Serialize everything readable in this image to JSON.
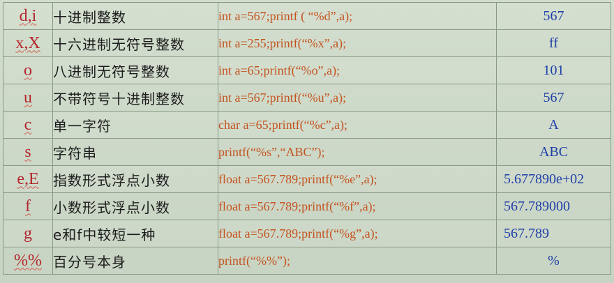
{
  "rows": [
    {
      "spec": "d,i",
      "desc": "十进制整数",
      "code": "int a=567;printf ( “%d”,a);",
      "output": "567"
    },
    {
      "spec": "x,X",
      "desc": "十六进制无符号整数",
      "code": "int a=255;printf(“%x”,a);",
      "output": "ff"
    },
    {
      "spec": "o",
      "desc": "八进制无符号整数",
      "code": "int a=65;printf(“%o”,a);",
      "output": "101"
    },
    {
      "spec": "u",
      "desc": "不带符号十进制整数",
      "code": "int a=567;printf(“%u”,a);",
      "output": "567"
    },
    {
      "spec": "c",
      "desc": "单一字符",
      "code": "char a=65;printf(“%c”,a);",
      "output": "A"
    },
    {
      "spec": "s",
      "desc": "字符串",
      "code": "printf(“%s”,“ABC”);",
      "output": "ABC"
    },
    {
      "spec": "e,E",
      "desc": "指数形式浮点小数",
      "code": "float a=567.789;printf(“%e”,a);",
      "output": "5.677890e+02"
    },
    {
      "spec": "f",
      "desc": "小数形式浮点小数",
      "code": "float a=567.789;printf(“%f”,a);",
      "output": "567.789000"
    },
    {
      "spec": "g",
      "desc": "e和f中较短一种",
      "code": "float a=567.789;printf(“%g”,a);",
      "output": "567.789"
    },
    {
      "spec": "%%",
      "desc": "百分号本身",
      "code": "printf(“%%”);",
      "output": "%"
    }
  ]
}
